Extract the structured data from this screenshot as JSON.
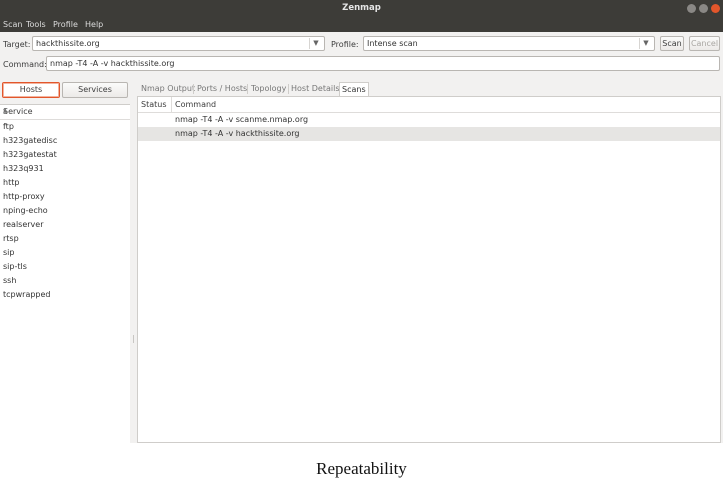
{
  "window": {
    "title": "Zenmap"
  },
  "menu": [
    "Scan",
    "Tools",
    "Profile",
    "Help"
  ],
  "target": {
    "label": "Target:",
    "value": "hackthissite.org"
  },
  "profile": {
    "label": "Profile:",
    "value": "Intense scan"
  },
  "buttons": {
    "scan": "Scan",
    "cancel": "Cancel"
  },
  "command": {
    "label": "Command:",
    "value": "nmap -T4 -A -v hackthissite.org"
  },
  "left": {
    "hosts_label": "Hosts",
    "services_label": "Services",
    "list_header": "Service",
    "services": [
      "ftp",
      "h323gatedisc",
      "h323gatestat",
      "h323q931",
      "http",
      "http-proxy",
      "nping-echo",
      "realserver",
      "rtsp",
      "sip",
      "sip-tls",
      "ssh",
      "tcpwrapped"
    ]
  },
  "tabs": [
    "Nmap Output",
    "Ports / Hosts",
    "Topology",
    "Host Details",
    "Scans"
  ],
  "active_tab": "Scans",
  "scans": {
    "columns": {
      "status": "Status",
      "command": "Command"
    },
    "rows": [
      {
        "status": "",
        "command": "nmap -T4 -A -v scanme.nmap.org",
        "selected": false
      },
      {
        "status": "",
        "command": "nmap -T4 -A -v hackthissite.org",
        "selected": true
      }
    ]
  },
  "caption": "Repeatability",
  "colors": {
    "titlebar": "#3d3c38",
    "accent": "#e2562b",
    "window_bg": "#f2f1f0"
  }
}
